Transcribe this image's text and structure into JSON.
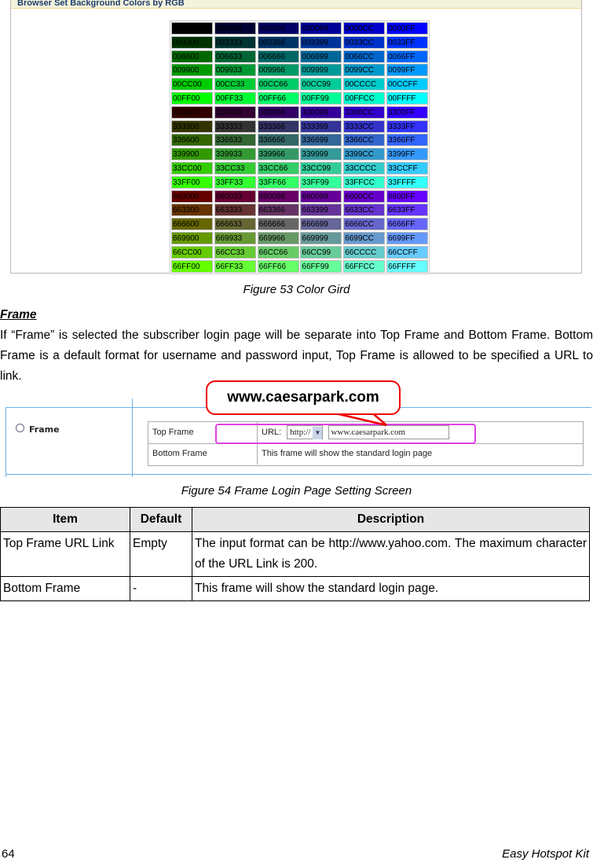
{
  "figure53": {
    "header": "Browser Set Background Colors by RGB",
    "caption": "Figure 53 Color Gird",
    "rows": [
      [
        "000000",
        "000033",
        "000066",
        "000099",
        "0000CC",
        "0000FF"
      ],
      [
        "003300",
        "003333",
        "003366",
        "003399",
        "0033CC",
        "0033FF"
      ],
      [
        "006600",
        "006633",
        "006666",
        "006699",
        "0066CC",
        "0066FF"
      ],
      [
        "009900",
        "009933",
        "009966",
        "009999",
        "0099CC",
        "0099FF"
      ],
      [
        "00CC00",
        "00CC33",
        "00CC66",
        "00CC99",
        "00CCCC",
        "00CCFF"
      ],
      [
        "00FF00",
        "00FF33",
        "00FF66",
        "00FF99",
        "00FFCC",
        "00FFFF"
      ],
      [
        "330000",
        "330033",
        "330066",
        "330099",
        "3300CC",
        "3300FF"
      ],
      [
        "333300",
        "333333",
        "333366",
        "333399",
        "3333CC",
        "3333FF"
      ],
      [
        "336600",
        "336633",
        "336666",
        "336699",
        "3366CC",
        "3366FF"
      ],
      [
        "339900",
        "339933",
        "339966",
        "339999",
        "3399CC",
        "3399FF"
      ],
      [
        "33CC00",
        "33CC33",
        "33CC66",
        "33CC99",
        "33CCCC",
        "33CCFF"
      ],
      [
        "33FF00",
        "33FF33",
        "33FF66",
        "33FF99",
        "33FFCC",
        "33FFFF"
      ],
      [
        "660000",
        "660033",
        "660066",
        "660099",
        "6600CC",
        "6600FF"
      ],
      [
        "663300",
        "663333",
        "663366",
        "663399",
        "6633CC",
        "6633FF"
      ],
      [
        "666600",
        "666633",
        "666666",
        "666699",
        "6666CC",
        "6666FF"
      ],
      [
        "669900",
        "669933",
        "669966",
        "669999",
        "6699CC",
        "6699FF"
      ],
      [
        "66CC00",
        "66CC33",
        "66CC66",
        "66CC99",
        "66CCCC",
        "66CCFF"
      ],
      [
        "66FF00",
        "66FF33",
        "66FF66",
        "66FF99",
        "66FFCC",
        "66FFFF"
      ]
    ]
  },
  "section": {
    "heading": "Frame",
    "body": "If “Frame” is selected the subscriber login page will be separate into Top Frame and Bottom Frame. Bottom Frame is a default format for username and password input, Top Frame is allowed to be specified a URL to link."
  },
  "figure54": {
    "callout": "www.caesarpark.com",
    "radio_label": "Frame",
    "top_label": "Top Frame",
    "url_label": "URL:",
    "protocol": "http://",
    "url_value": "www.caesarpark.com",
    "bottom_label": "Bottom Frame",
    "bottom_desc": "This frame will show the standard login page",
    "caption": "Figure 54 Frame Login Page Setting Screen"
  },
  "table": {
    "headers": [
      "Item",
      "Default",
      "Description"
    ],
    "rows": [
      [
        "Top Frame URL Link",
        "Empty",
        "The input format can be http://www.yahoo.com. The maximum character of the URL Link is 200."
      ],
      [
        "Bottom Frame",
        "-",
        "This frame will show the standard login page."
      ]
    ]
  },
  "footer": {
    "page": "64",
    "title": "Easy Hotspot Kit"
  }
}
